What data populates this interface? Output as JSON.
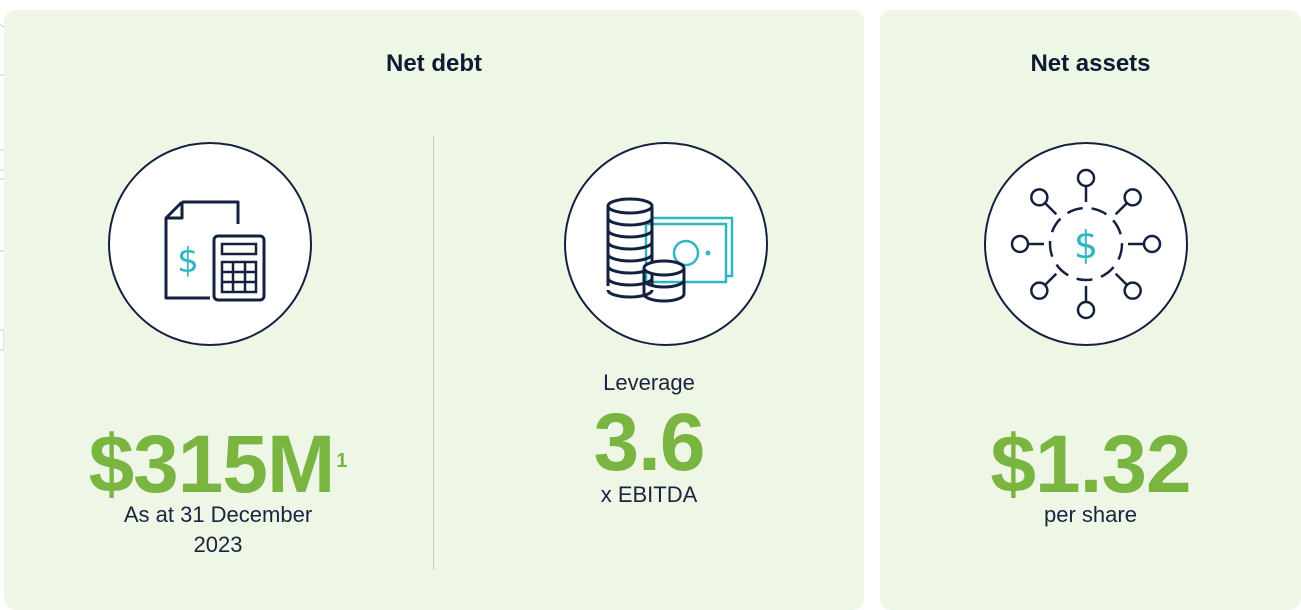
{
  "net_debt": {
    "title": "Net debt",
    "left": {
      "icon": "invoice-calculator-icon",
      "value": "$315M",
      "footnote": "1",
      "caption_line1": "As at 31 December",
      "caption_line2": "2023"
    },
    "right": {
      "icon": "coins-cash-icon",
      "label": "Leverage",
      "value": "3.6",
      "caption": "x EBITDA"
    }
  },
  "net_assets": {
    "title": "Net assets",
    "icon": "dollar-network-icon",
    "value": "$1.32",
    "caption": "per share"
  },
  "colors": {
    "background_card": "#eef6e6",
    "accent_green": "#7ab542",
    "navy": "#13213f",
    "teal": "#2fb6c2"
  }
}
